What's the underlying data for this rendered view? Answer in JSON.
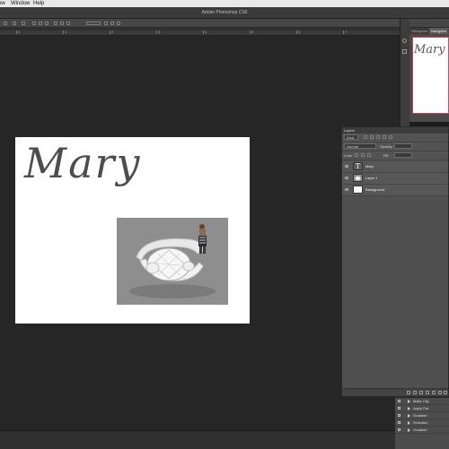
{
  "menubar": {
    "items": [
      "ow",
      "Window",
      "Help"
    ]
  },
  "window": {
    "title": "Adobe Photoshop CS6"
  },
  "ruler": {
    "labels": [
      "0",
      "1",
      "2",
      "3",
      "4",
      "5",
      "6",
      "7"
    ]
  },
  "document": {
    "text_layer": "Mary"
  },
  "navigator": {
    "tabs": [
      "Histogram",
      "Navigator"
    ],
    "preview_text": "Mary"
  },
  "layers": {
    "title": "Layers",
    "filter": "Kind",
    "blend_mode": "Normal",
    "opacity_label": "Opacity:",
    "lock_label": "Lock:",
    "fill_label": "Fill:",
    "items": [
      {
        "name": "Mary",
        "type": "text"
      },
      {
        "name": "Layer 1",
        "type": "image"
      },
      {
        "name": "Background",
        "type": "fill"
      }
    ]
  },
  "actions": {
    "items": [
      "Make Clip",
      "Apply Pat",
      "Gradient",
      "Selection",
      "Gradient"
    ]
  },
  "colors": {
    "selection_border": "#d0455c",
    "canvas_bg": "#262626",
    "panel_bg": "#505050"
  }
}
